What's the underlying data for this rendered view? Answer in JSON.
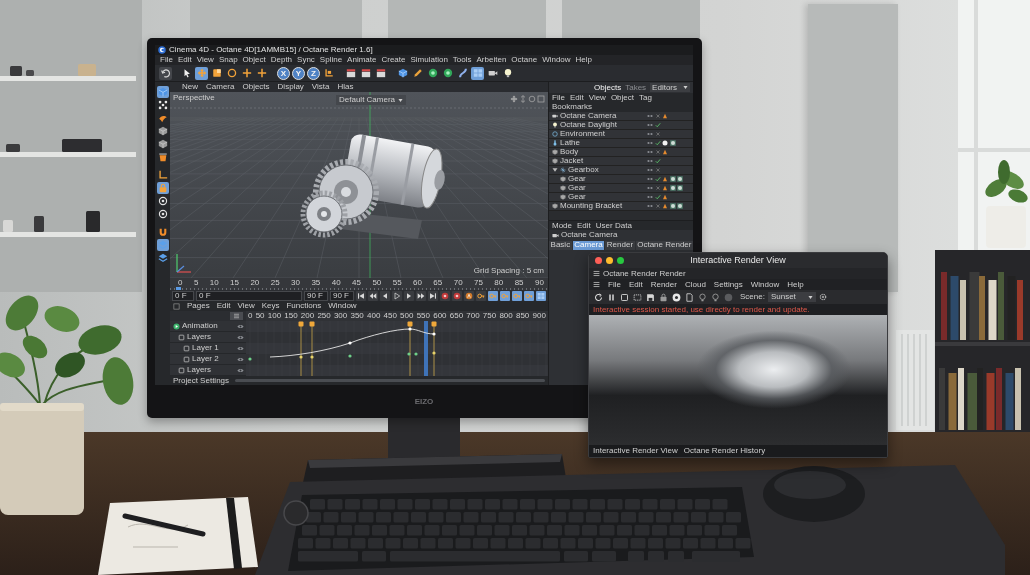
{
  "monitor": {
    "logo": "EIZO",
    "app": {
      "title": "Cinema 4D - Octane 4D[1AMMB15] / Octane Render 1.6]",
      "menu": [
        "File",
        "Edit",
        "View",
        "Snap",
        "Object",
        "Depth",
        "Sync",
        "Spline",
        "Animate",
        "Create",
        "Simulation",
        "Tools",
        "Arbeiten",
        "Octane",
        "Window",
        "Help"
      ],
      "toolbar": [
        {
          "kind": "undo",
          "selected": false
        },
        {
          "kind": "cursor",
          "selected": false
        },
        {
          "kind": "move",
          "selected": true
        },
        {
          "kind": "scale",
          "selected": false
        },
        {
          "kind": "rotate",
          "selected": false
        },
        {
          "kind": "plus",
          "selected": false
        },
        {
          "kind": "plus",
          "selected": false
        },
        {
          "kind": "axis",
          "label": "X",
          "selected": true
        },
        {
          "kind": "axis",
          "label": "Y",
          "selected": true
        },
        {
          "kind": "axis",
          "label": "Z",
          "selected": true
        },
        {
          "kind": "coord",
          "selected": false
        },
        {
          "kind": "clapper",
          "selected": false
        },
        {
          "kind": "clapper",
          "selected": false
        },
        {
          "kind": "clapper",
          "selected": false
        },
        {
          "kind": "cube",
          "selected": false
        },
        {
          "kind": "pen",
          "selected": false
        },
        {
          "kind": "gem",
          "selected": false
        },
        {
          "kind": "gem",
          "selected": false
        },
        {
          "kind": "bend",
          "selected": false
        },
        {
          "kind": "grid",
          "selected": true
        },
        {
          "kind": "camera",
          "selected": false
        },
        {
          "kind": "light",
          "selected": false
        }
      ],
      "left_tools": [
        {
          "kind": "cube",
          "selected": true
        },
        {
          "kind": "points",
          "selected": false
        },
        {
          "kind": "paint",
          "selected": false
        },
        {
          "kind": "box",
          "selected": false
        },
        {
          "kind": "box",
          "selected": false
        },
        {
          "kind": "bucket",
          "selected": false
        },
        {
          "kind": "corner",
          "selected": false
        },
        {
          "kind": "lock",
          "selected": true
        },
        {
          "kind": "ring",
          "selected": false
        },
        {
          "kind": "ring",
          "selected": false
        },
        {
          "kind": "magnet",
          "selected": false
        },
        {
          "kind": "layers",
          "selected": true
        },
        {
          "kind": "layers",
          "selected": false
        }
      ],
      "viewport": {
        "menu": [
          "New",
          "Camera",
          "Objects",
          "Display",
          "Vista",
          "Hlas"
        ],
        "label": "Perspective",
        "camera": "Default Camera",
        "grid": "Grid Spacing : 5 cm"
      },
      "object_manager": {
        "tabs": [
          {
            "label": "Objects",
            "selected": true
          },
          {
            "label": "Takes",
            "selected": false
          }
        ],
        "dropdown": "Editors",
        "menu": [
          "File",
          "Edit",
          "View",
          "Object",
          "Tag",
          "Bookmarks"
        ],
        "objects": [
          {
            "name": "Octane Camera",
            "kind": "camera",
            "checked": false,
            "tags": [
              {
                "kind": "phong"
              }
            ]
          },
          {
            "name": "Octane Daylight",
            "kind": "light",
            "checked": true
          },
          {
            "name": "Environment",
            "kind": "sky",
            "checked": false
          },
          {
            "name": "Lathe",
            "kind": "lathe",
            "checked": true,
            "tags": [
              {
                "kind": "sky"
              },
              {
                "kind": "material"
              }
            ]
          },
          {
            "name": "Body",
            "kind": "object",
            "checked": false,
            "tags": [
              {
                "kind": "phong"
              }
            ]
          },
          {
            "name": "Jacket",
            "kind": "object",
            "checked": true
          },
          {
            "name": "Gearbox",
            "kind": "group",
            "checked": false,
            "expanded": true,
            "children": [
              {
                "name": "Gear",
                "kind": "object",
                "checked": true,
                "tags": [
                  {
                    "kind": "phong"
                  },
                  {
                    "kind": "material"
                  },
                  {
                    "kind": "material"
                  }
                ]
              },
              {
                "name": "Gear",
                "kind": "object",
                "checked": false,
                "tags": [
                  {
                    "kind": "phong"
                  },
                  {
                    "kind": "material"
                  },
                  {
                    "kind": "material"
                  }
                ]
              },
              {
                "name": "Gear",
                "kind": "object",
                "checked": true,
                "tags": [
                  {
                    "kind": "phong"
                  }
                ]
              }
            ]
          },
          {
            "name": "Mounting Bracket",
            "kind": "object",
            "checked": false,
            "tags": [
              {
                "kind": "phong"
              },
              {
                "kind": "material"
              },
              {
                "kind": "material"
              }
            ]
          }
        ]
      },
      "attributes": {
        "menu": [
          "Mode",
          "Edit",
          "User Data"
        ],
        "object": "Octane Camera",
        "tabs": [
          {
            "label": "Basic",
            "selected": false
          },
          {
            "label": "Camera",
            "selected": true
          },
          {
            "label": "Render",
            "selected": false
          },
          {
            "label": "Octane Render",
            "selected": false
          }
        ]
      },
      "timeline": {
        "ruler": [
          "0",
          "5",
          "10",
          "15",
          "20",
          "25",
          "30",
          "35",
          "40",
          "45",
          "50",
          "55",
          "60",
          "65",
          "70",
          "75",
          "80",
          "85",
          "90"
        ],
        "fields": [
          "0 F",
          "0 F",
          "90 F",
          "90 F"
        ],
        "key_modes": [
          {
            "kind": "key",
            "selected": false
          },
          {
            "kind": "key",
            "selected": true
          },
          {
            "kind": "key",
            "selected": true
          },
          {
            "kind": "key",
            "selected": true
          },
          {
            "kind": "key",
            "selected": true
          },
          {
            "kind": "grid",
            "selected": true
          }
        ],
        "menu": [
          "Pages",
          "Edit",
          "View",
          "Keys",
          "Functions",
          "Window"
        ],
        "scale": [
          "0",
          "50",
          "100",
          "150",
          "200",
          "250",
          "300",
          "350",
          "400",
          "450",
          "500",
          "550",
          "600",
          "650",
          "700",
          "750",
          "800",
          "850",
          "900"
        ],
        "tracks": [
          {
            "name": "Animation",
            "kind": "anim",
            "children": [
              {
                "name": "Layers",
                "kind": "layer",
                "children": [
                  {
                    "name": "Layer 1",
                    "kind": "layer"
                  },
                  {
                    "name": "Layer 2",
                    "kind": "layer"
                  }
                ]
              },
              {
                "name": "Layers",
                "kind": "layer"
              }
            ]
          }
        ],
        "footer": "Project Settings"
      }
    }
  },
  "render_view": {
    "title": "Interactive Render View",
    "tab": "Octane Render Render",
    "menu": [
      "File",
      "Edit",
      "Render",
      "Cloud",
      "Settings",
      "Window",
      "Help"
    ],
    "scene_label": "Scene:",
    "scene": "Sunset",
    "message": "Interactive session started, use directly to render and update.",
    "status": [
      "Interactive Render View",
      "Octane Render History"
    ]
  }
}
